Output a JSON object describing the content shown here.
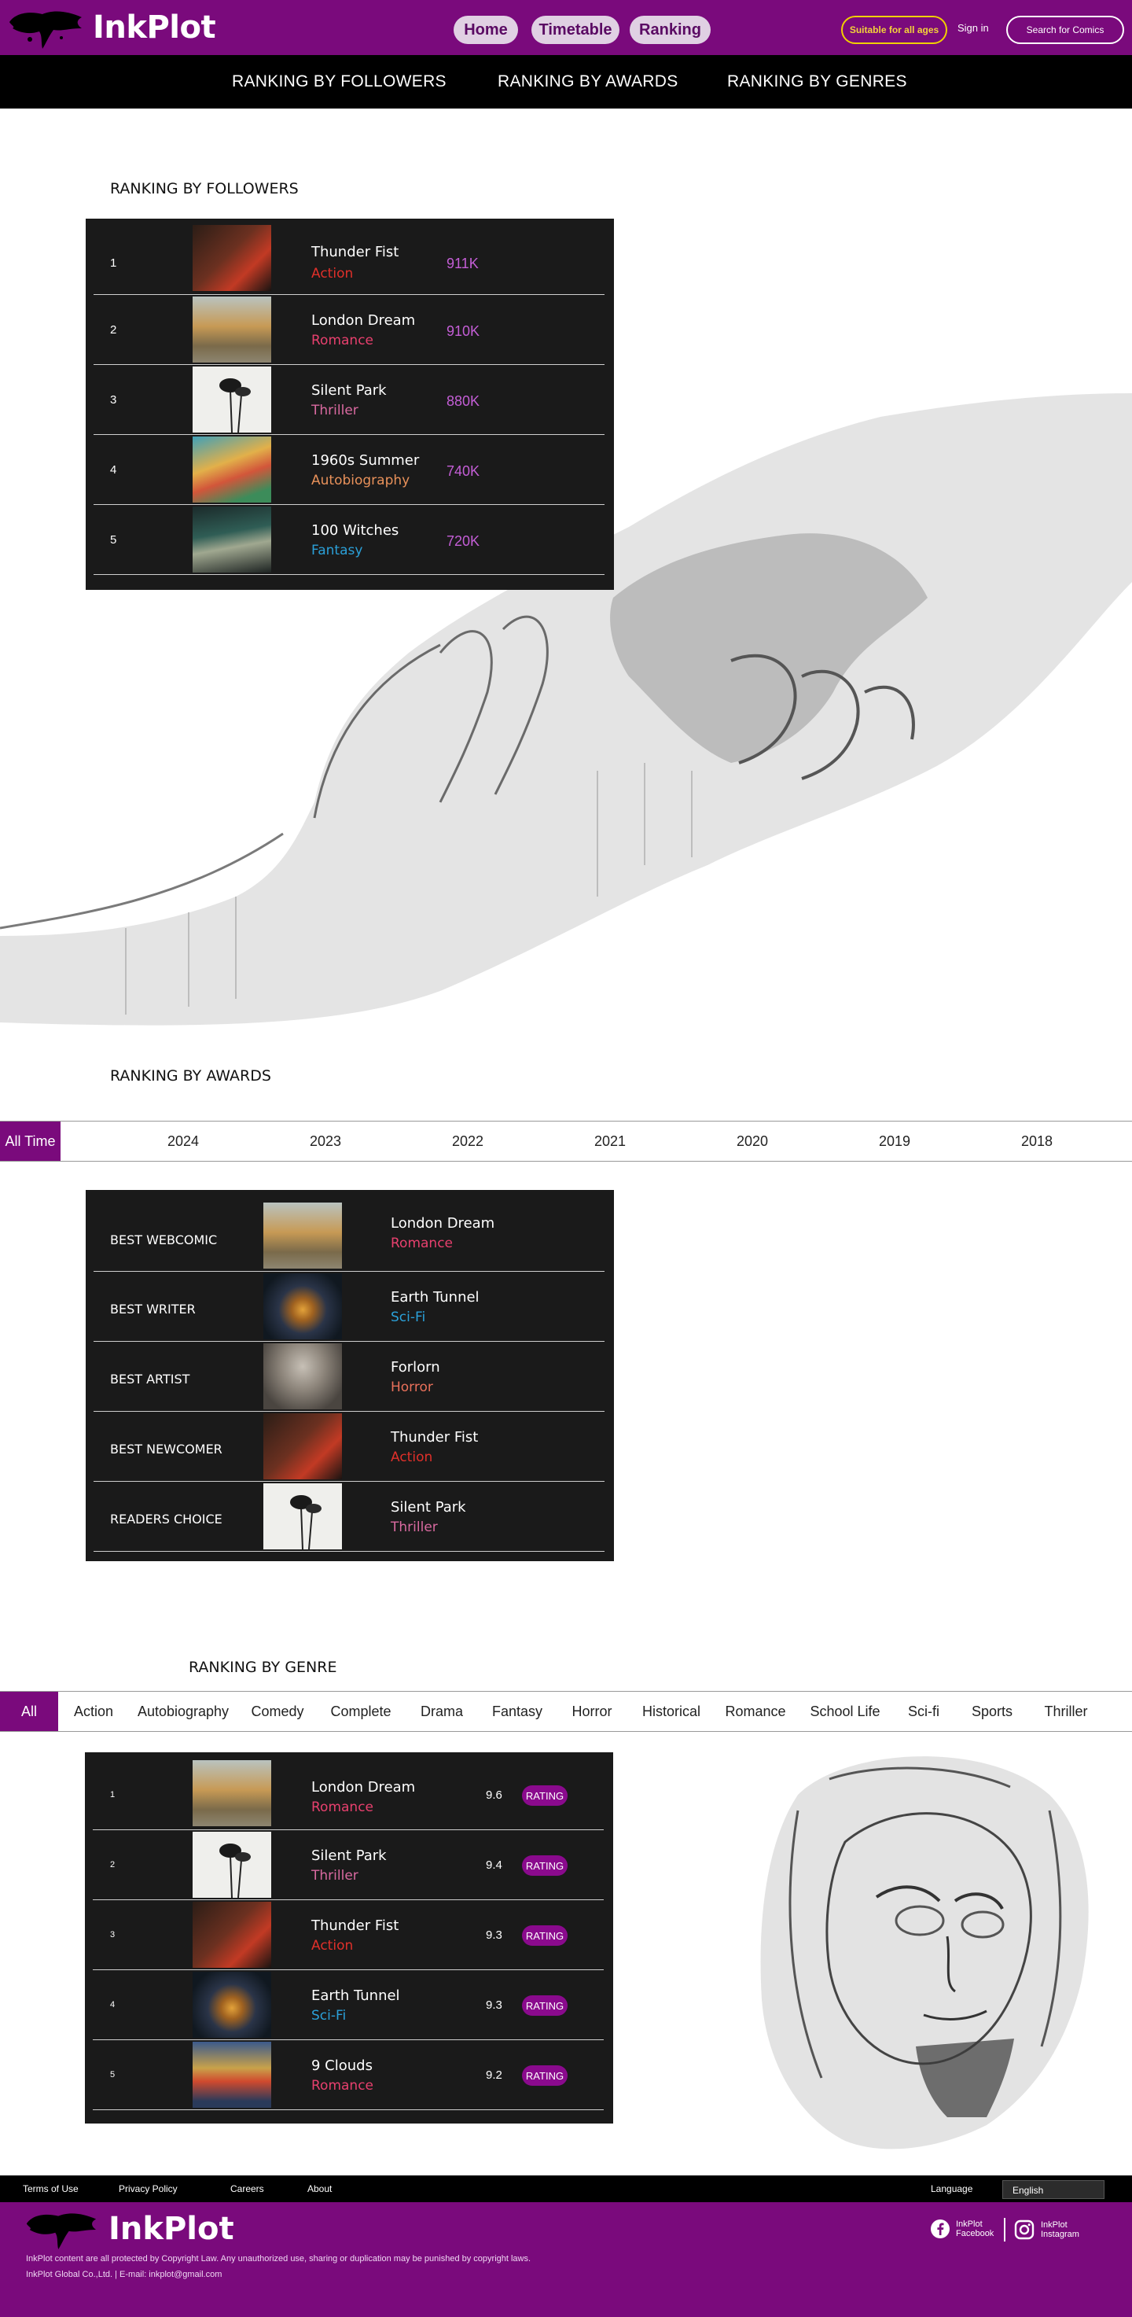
{
  "header": {
    "logo": "InkPlot",
    "nav": [
      "Home",
      "Timetable",
      "Ranking"
    ],
    "age_badge": "Suitable for all ages",
    "signin": "Sign in",
    "search": "Search for Comics"
  },
  "subnav": [
    "RANKING BY FOLLOWERS",
    "RANKING BY AWARDS",
    "RANKING BY GENRES"
  ],
  "followers": {
    "title": "RANKING BY FOLLOWERS",
    "rows": [
      {
        "rank": "1",
        "title": "Thunder Fist",
        "genre": "Action",
        "count": "911K"
      },
      {
        "rank": "2",
        "title": "London Dream",
        "genre": "Romance",
        "count": "910K"
      },
      {
        "rank": "3",
        "title": "Silent Park",
        "genre": "Thriller",
        "count": "880K"
      },
      {
        "rank": "4",
        "title": "1960s Summer",
        "genre": "Autobiography",
        "count": "740K"
      },
      {
        "rank": "5",
        "title": "100 Witches",
        "genre": "Fantasy",
        "count": "720K"
      }
    ]
  },
  "awards": {
    "title": "RANKING BY AWARDS",
    "tabs": [
      "All Time",
      "2024",
      "2023",
      "2022",
      "2021",
      "2020",
      "2019",
      "2018"
    ],
    "rows": [
      {
        "award": "BEST WEBCOMIC",
        "title": "London Dream",
        "genre": "Romance"
      },
      {
        "award": "BEST WRITER",
        "title": "Earth Tunnel",
        "genre": "Sci-Fi"
      },
      {
        "award": "BEST ARTIST",
        "title": "Forlorn",
        "genre": "Horror"
      },
      {
        "award": "BEST NEWCOMER",
        "title": "Thunder Fist",
        "genre": "Action"
      },
      {
        "award": "READERS CHOICE",
        "title": "Silent Park",
        "genre": "Thriller"
      }
    ]
  },
  "genre": {
    "title": "RANKING BY GENRE",
    "tabs": [
      "All",
      "Action",
      "Autobiography",
      "Comedy",
      "Complete",
      "Drama",
      "Fantasy",
      "Horror",
      "Historical",
      "Romance",
      "School Life",
      "Sci-fi",
      "Sports",
      "Thriller"
    ],
    "rating_label": "RATING",
    "rows": [
      {
        "rank": "1",
        "title": "London Dream",
        "genre": "Romance",
        "score": "9.6"
      },
      {
        "rank": "2",
        "title": "Silent Park",
        "genre": "Thriller",
        "score": "9.4"
      },
      {
        "rank": "3",
        "title": "Thunder Fist",
        "genre": "Action",
        "score": "9.3"
      },
      {
        "rank": "4",
        "title": "Earth Tunnel",
        "genre": "Sci-Fi",
        "score": "9.3"
      },
      {
        "rank": "5",
        "title": "9 Clouds",
        "genre": "Romance",
        "score": "9.2"
      }
    ]
  },
  "footer": {
    "links": [
      "Terms of Use",
      "Privacy Policy",
      "Careers",
      "About"
    ],
    "language_label": "Language",
    "language_value": "English",
    "logo": "InkPlot",
    "copyright": "InkPlot content are all protected by Copyright Law. Any unauthorized use, sharing or duplication may be punished by copyright laws.",
    "company": "InkPlot Global Co.,Ltd. | E-mail: inkplot@gmail.com",
    "social": [
      {
        "icon": "facebook-icon",
        "line1": "InkPlot",
        "line2": "Facebook"
      },
      {
        "icon": "instagram-icon",
        "line1": "InkPlot",
        "line2": "Instagram"
      }
    ]
  },
  "colors": {
    "brand": "#7a0a7c",
    "Action": "#e0302a",
    "Romance": "#e8406e",
    "Thriller": "#d96aa0",
    "Autobiography": "#e8915a",
    "Fantasy": "#2ba0d8",
    "Sci-Fi": "#2ba0d8",
    "Horror": "#e8705a"
  }
}
